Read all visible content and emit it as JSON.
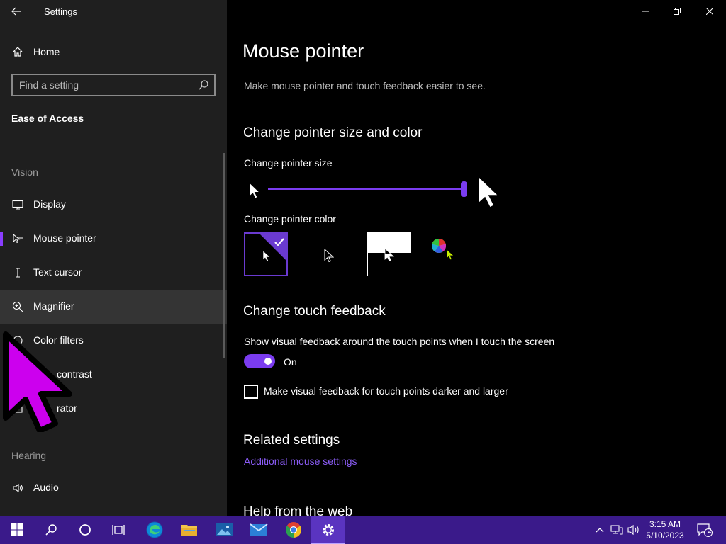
{
  "app": {
    "title": "Settings"
  },
  "sidebar": {
    "home_label": "Home",
    "search": {
      "placeholder": "Find a setting"
    },
    "section": "Ease of Access",
    "groups": {
      "vision": "Vision",
      "hearing": "Hearing"
    },
    "items": [
      {
        "label": "Display",
        "icon": "monitor-icon"
      },
      {
        "label": "Mouse pointer",
        "icon": "pointer-icon",
        "selected": true
      },
      {
        "label": "Text cursor",
        "icon": "text-cursor-icon"
      },
      {
        "label": "Magnifier",
        "icon": "magnifier-icon"
      },
      {
        "label": "Color filters",
        "icon": "color-filters-icon"
      },
      {
        "label": "contrast",
        "icon": "high-contrast-icon"
      },
      {
        "label": "rator",
        "icon": "narrator-icon"
      },
      {
        "label": "Audio",
        "icon": "audio-icon"
      }
    ]
  },
  "main": {
    "title": "Mouse pointer",
    "subtitle": "Make mouse pointer and touch feedback easier to see.",
    "size_color": {
      "heading": "Change pointer size and color",
      "size_label": "Change pointer size",
      "size_value_fraction": 1.0,
      "color_label": "Change pointer color",
      "selected_color_option": 1
    },
    "touch": {
      "heading": "Change touch feedback",
      "show_label": "Show visual feedback around the touch points when I touch the screen",
      "toggle_state": "On",
      "darker_label": "Make visual feedback for touch points darker and larger",
      "darker_checked": false
    },
    "related": {
      "heading": "Related settings",
      "link": "Additional mouse settings"
    },
    "help_heading": "Help from the web"
  },
  "taskbar": {
    "apps": [
      "start-icon",
      "search-icon",
      "cortana-icon",
      "task-view-icon",
      "edge-icon",
      "file-explorer-icon",
      "photos-icon",
      "mail-icon",
      "chrome-icon",
      "settings-icon"
    ],
    "time": "3:15 AM",
    "date": "5/10/2023",
    "notifications": "2"
  },
  "colors": {
    "accent": "#7b3cf0",
    "sidebar_bg": "#1f1f1f",
    "taskbar_bg": "#3a1a8a",
    "big_cursor": "#cc00ee",
    "link": "#8a5cf5"
  }
}
